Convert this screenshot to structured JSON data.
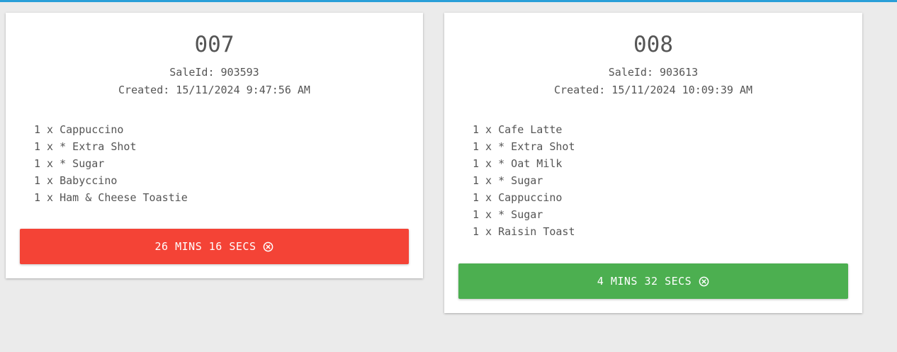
{
  "orders": [
    {
      "number": "007",
      "sale_id": "SaleId: 903593",
      "created": "Created: 15/11/2024 9:47:56 AM",
      "items": [
        "1 x Cappuccino",
        "1 x * Extra Shot",
        "1 x * Sugar",
        "1 x Babyccino",
        "1 x Ham & Cheese Toastie"
      ],
      "timer_label": "26 MINS 16 SECS",
      "timer_color": "#f44336",
      "timer_icon": "close-circle-icon"
    },
    {
      "number": "008",
      "sale_id": "SaleId: 903613",
      "created": "Created: 15/11/2024 10:09:39 AM",
      "items": [
        "1 x Cafe Latte",
        "1 x * Extra Shot",
        "1 x * Oat Milk",
        "1 x * Sugar",
        "1 x Cappuccino",
        "1 x * Sugar",
        "1 x Raisin Toast"
      ],
      "timer_label": "4 MINS 32 SECS",
      "timer_color": "#4caf50",
      "timer_icon": "close-circle-icon"
    }
  ],
  "colors": {
    "accent_bar": "#2a9fd8",
    "background": "#ebebeb",
    "text": "#555555"
  }
}
